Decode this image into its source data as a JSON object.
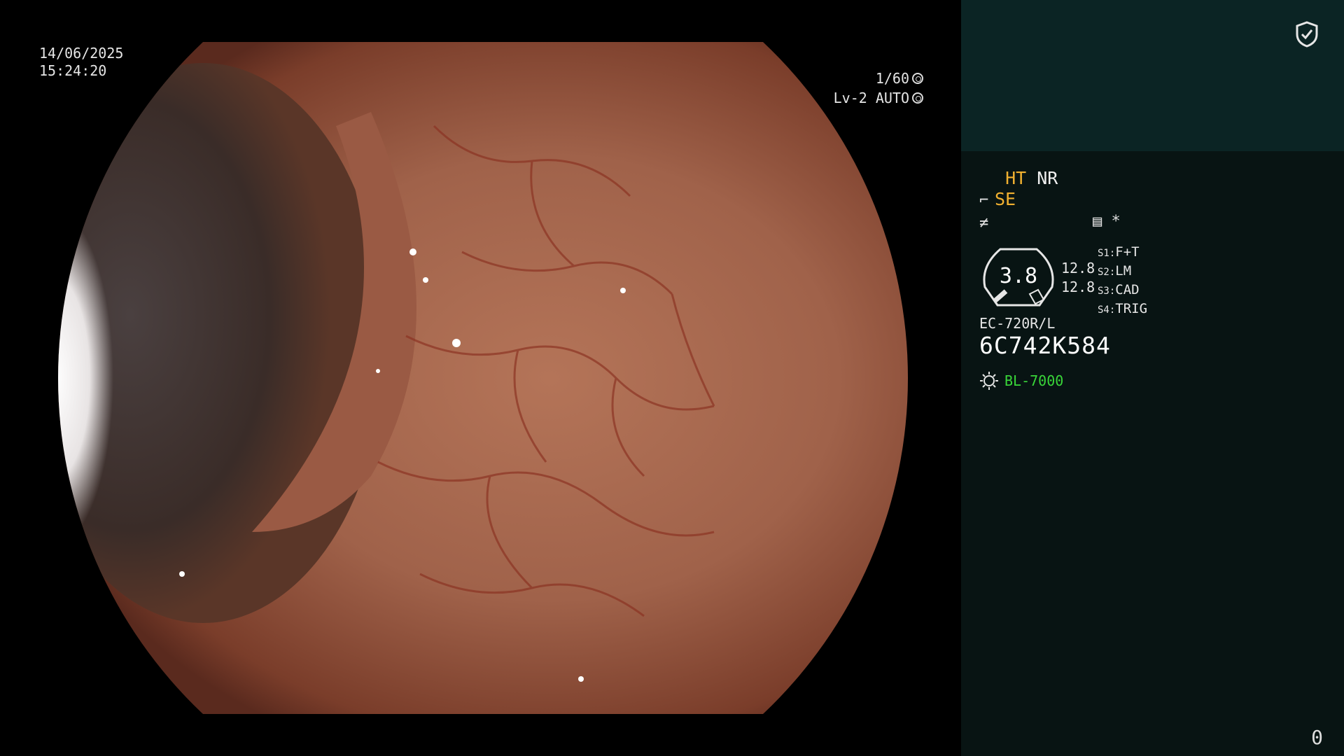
{
  "overlay": {
    "date": "14/06/2025",
    "time": "15:24:20",
    "shutter": "1/60",
    "level": "Lv-2 AUTO"
  },
  "panel": {
    "mode_ht": "HT",
    "mode_nr": "NR",
    "mode_se": "SE",
    "star": "*",
    "zoom_value": "3.8",
    "val_a": "12.8",
    "val_b": "12.8",
    "switches": [
      {
        "key": "S1:",
        "value": "F+T"
      },
      {
        "key": "S2:",
        "value": "LM"
      },
      {
        "key": "S3:",
        "value": "CAD"
      },
      {
        "key": "S4:",
        "value": "TRIG"
      }
    ],
    "scope_model": "EC-720R/L",
    "serial": "6C742K584",
    "light_source": "BL-7000",
    "counter": "0"
  },
  "icons": {
    "shield": "shield-check-icon",
    "shutter": "aperture-icon",
    "auto": "iris-icon",
    "scope": "scope-icon",
    "freeze": "freeze-icon",
    "memo": "memo-icon",
    "light": "sun-icon"
  },
  "colors": {
    "panel_bg": "#081413",
    "panel_top": "#0b2424",
    "yellow": "#f0b030",
    "green": "#39d639",
    "tissue": "#a0624a"
  }
}
